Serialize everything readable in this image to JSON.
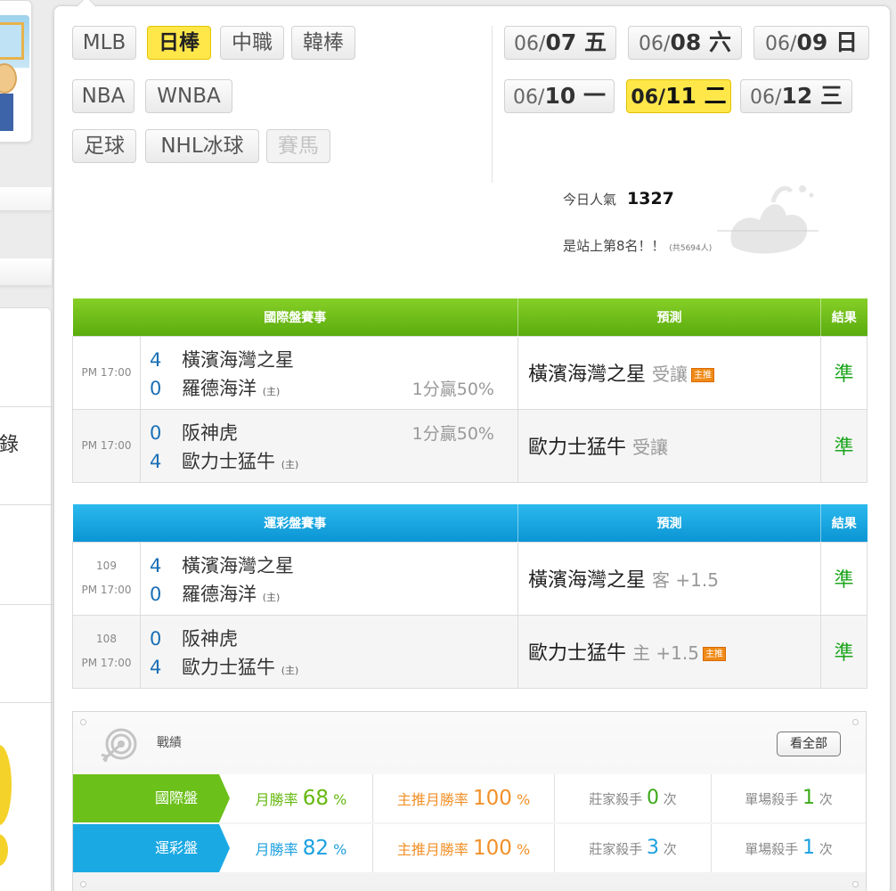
{
  "sidebar": {
    "menu_text": "錄"
  },
  "categories": [
    {
      "label": "MLB",
      "state": "normal"
    },
    {
      "label": "日棒",
      "state": "active"
    },
    {
      "label": "中職",
      "state": "normal"
    },
    {
      "label": "韓棒",
      "state": "normal"
    },
    {
      "label": "NBA",
      "state": "normal"
    },
    {
      "label": "WNBA",
      "state": "normal"
    },
    {
      "label": "足球",
      "state": "normal"
    },
    {
      "label": "NHL冰球",
      "state": "normal"
    },
    {
      "label": "賽馬",
      "state": "disabled"
    }
  ],
  "dates": [
    {
      "md": "06/",
      "day": "07 五",
      "active": false
    },
    {
      "md": "06/",
      "day": "08 六",
      "active": false
    },
    {
      "md": "06/",
      "day": "09 日",
      "active": false
    },
    {
      "md": "06/",
      "day": "10 一",
      "active": false
    },
    {
      "md": "06/",
      "day": "11 二",
      "active": true
    },
    {
      "md": "06/",
      "day": "12 三",
      "active": false
    }
  ],
  "popularity": {
    "label": "今日人氣",
    "value": "1327",
    "rank_text": "是站上第8名！！",
    "total_text": "(共5694人)"
  },
  "intl_table": {
    "headers": {
      "match": "國際盤賽事",
      "predict": "預測",
      "result": "結果"
    },
    "rows": [
      {
        "num": "",
        "time": "PM 17:00",
        "team1": {
          "score": "4",
          "name": "橫濱海灣之星",
          "home": ""
        },
        "team2": {
          "score": "0",
          "name": "羅德海洋",
          "home": "(主)"
        },
        "odds": "1分贏50%",
        "odds_row": 2,
        "prediction": "橫濱海灣之星",
        "hint": "受讓",
        "tag": "主推",
        "result": "準"
      },
      {
        "num": "",
        "time": "PM 17:00",
        "team1": {
          "score": "0",
          "name": "阪神虎",
          "home": ""
        },
        "team2": {
          "score": "4",
          "name": "歐力士猛牛",
          "home": "(主)"
        },
        "odds": "1分贏50%",
        "odds_row": 1,
        "prediction": "歐力士猛牛",
        "hint": "受讓",
        "tag": "",
        "result": "準"
      }
    ]
  },
  "lottery_table": {
    "headers": {
      "match": "運彩盤賽事",
      "predict": "預測",
      "result": "結果"
    },
    "rows": [
      {
        "num": "109",
        "time": "PM 17:00",
        "team1": {
          "score": "4",
          "name": "橫濱海灣之星",
          "home": ""
        },
        "team2": {
          "score": "0",
          "name": "羅德海洋",
          "home": "(主)"
        },
        "odds": "",
        "odds_row": 0,
        "prediction": "橫濱海灣之星",
        "hint": "客 +1.5",
        "tag": "",
        "result": "準"
      },
      {
        "num": "108",
        "time": "PM 17:00",
        "team1": {
          "score": "0",
          "name": "阪神虎",
          "home": ""
        },
        "team2": {
          "score": "4",
          "name": "歐力士猛牛",
          "home": "(主)"
        },
        "odds": "",
        "odds_row": 0,
        "prediction": "歐力士猛牛",
        "hint": "主 +1.5",
        "tag": "主推",
        "result": "準"
      }
    ]
  },
  "record": {
    "title": "戰績",
    "see_all": "看全部",
    "rows": [
      {
        "label": "國際盤",
        "month_prefix": "月勝率",
        "month_rate": "68",
        "month_unit": "%",
        "top_prefix": "主推月勝率",
        "top_rate": "100",
        "top_unit": "%",
        "banker_prefix": "莊家殺手",
        "banker": "0",
        "banker_unit": "次",
        "single_prefix": "單場殺手",
        "single": "1",
        "single_unit": "次"
      },
      {
        "label": "運彩盤",
        "month_prefix": "月勝率",
        "month_rate": "82",
        "month_unit": "%",
        "top_prefix": "主推月勝率",
        "top_rate": "100",
        "top_unit": "%",
        "banker_prefix": "莊家殺手",
        "banker": "3",
        "banker_unit": "次",
        "single_prefix": "單場殺手",
        "single": "1",
        "single_unit": "次"
      }
    ]
  },
  "colors": {
    "active_yellow": "#ffe74a",
    "intl_green": "#6cc01a",
    "lottery_blue": "#1ba9e4",
    "result_green": "#1da41d",
    "tag_orange": "#f08a17",
    "score_blue": "#1b6fb5"
  }
}
